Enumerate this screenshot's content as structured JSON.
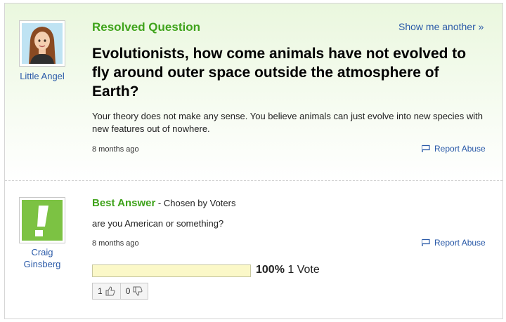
{
  "question": {
    "status_label": "Resolved Question",
    "show_another": "Show me another »",
    "asker": "Little Angel",
    "title": "Evolutionists, how come animals have not evolved to fly around outer space outside the atmosphere of Earth?",
    "body": "Your theory does not make any sense. You believe animals can just evolve into new species with new features out of nowhere.",
    "timestamp": "8 months ago",
    "report_label": "Report Abuse"
  },
  "answer": {
    "label": "Best Answer",
    "chosen_by": " - Chosen by Voters",
    "answerer": "Craig Ginsberg",
    "text": "are you American or something?",
    "timestamp": "8 months ago",
    "report_label": "Report Abuse",
    "vote_percent": "100%",
    "vote_fraction": 1.0,
    "vote_count": " 1 Vote",
    "thumbs_up": "1",
    "thumbs_down": "0"
  },
  "colors": {
    "accent_green": "#3fa31b",
    "link_blue": "#2a5aa8",
    "vote_bar_fill": "#fbf8c8"
  }
}
